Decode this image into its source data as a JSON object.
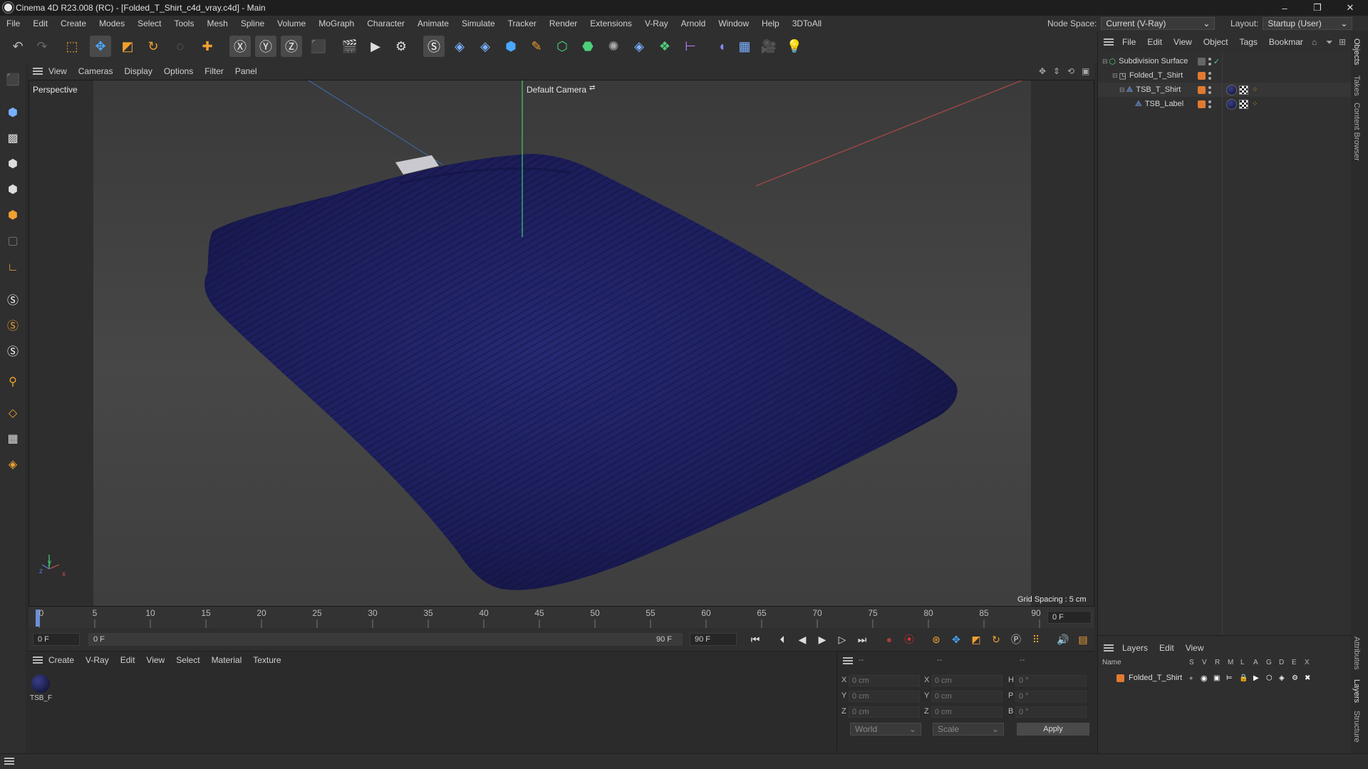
{
  "window": {
    "title": "Cinema 4D R23.008 (RC) - [Folded_T_Shirt_c4d_vray.c4d] - Main",
    "minimize": "–",
    "restore": "❐",
    "close": "✕"
  },
  "menubar": {
    "items": [
      "File",
      "Edit",
      "Create",
      "Modes",
      "Select",
      "Tools",
      "Mesh",
      "Spline",
      "Volume",
      "MoGraph",
      "Character",
      "Animate",
      "Simulate",
      "Tracker",
      "Render",
      "Extensions",
      "V-Ray",
      "Arnold",
      "Window",
      "Help",
      "3DToAll"
    ],
    "node_space_label": "Node Space:",
    "node_space_value": "Current (V-Ray)",
    "layout_label": "Layout:",
    "layout_value": "Startup (User)"
  },
  "toolbar": {
    "icons": [
      "undo-icon",
      "redo-icon",
      "live-select-icon",
      "move-icon",
      "scale-icon",
      "rotate-icon",
      "recent-tool-icon",
      "transform-icon",
      "x-axis-lock-icon",
      "y-axis-lock-icon",
      "z-axis-lock-icon",
      "coordinate-system-icon",
      "render-region-icon",
      "render-view-icon",
      "render-settings-icon",
      "vray-icon",
      "python-icon",
      "python-icon-2",
      "cube-icon",
      "pen-icon",
      "subdivision-icon",
      "extrude-icon",
      "cloner-icon",
      "python-icon-3",
      "mograph-icon",
      "symmetry-icon",
      "deformer-icon",
      "floor-icon",
      "camera-icon",
      "light-icon"
    ]
  },
  "viewport_menu": {
    "items": [
      "View",
      "Cameras",
      "Display",
      "Options",
      "Filter",
      "Panel"
    ]
  },
  "viewport": {
    "label": "Perspective",
    "camera": "Default Camera",
    "grid_spacing": "Grid Spacing : 5 cm",
    "axis_x": "x",
    "axis_y": "y",
    "axis_z": "z",
    "shirt_color": "#1c1d52"
  },
  "timeline": {
    "ticks": [
      "0",
      "5",
      "10",
      "15",
      "20",
      "25",
      "30",
      "35",
      "40",
      "45",
      "50",
      "55",
      "60",
      "65",
      "70",
      "75",
      "80",
      "85",
      "90"
    ],
    "current_frame_field": "0 F"
  },
  "transport": {
    "start_frame": "0 F",
    "range_start": "0 F",
    "range_end": "90 F",
    "end_frame": "90 F"
  },
  "material_manager": {
    "menu": [
      "Create",
      "V-Ray",
      "Edit",
      "View",
      "Select",
      "Material",
      "Texture"
    ],
    "materials": [
      {
        "label": "TSB_F"
      }
    ]
  },
  "coordinates": {
    "header": [
      "--",
      "--",
      "--"
    ],
    "rows": [
      {
        "p": "X",
        "pv": "0 cm",
        "s": "X",
        "sv": "0 cm",
        "r": "H",
        "rv": "0 °"
      },
      {
        "p": "Y",
        "pv": "0 cm",
        "s": "Y",
        "sv": "0 cm",
        "r": "P",
        "rv": "0 °"
      },
      {
        "p": "Z",
        "pv": "0 cm",
        "s": "Z",
        "sv": "0 cm",
        "r": "B",
        "rv": "0 °"
      }
    ],
    "mode": "World",
    "type": "Scale",
    "apply": "Apply"
  },
  "object_manager": {
    "menu": [
      "File",
      "Edit",
      "View",
      "Object",
      "Tags",
      "Bookmar"
    ],
    "objects": [
      {
        "name": "Subdivision Surface"
      },
      {
        "name": "Folded_T_Shirt"
      },
      {
        "name": "TSB_T_Shirt"
      },
      {
        "name": "TSB_Label"
      }
    ]
  },
  "layer_manager": {
    "menu": [
      "Layers",
      "Edit",
      "View"
    ],
    "columns": [
      "Name",
      "S",
      "V",
      "R",
      "M",
      "L",
      "A",
      "G",
      "D",
      "E",
      "X"
    ],
    "layers": [
      {
        "name": "Folded_T_Shirt"
      }
    ]
  },
  "side_tabs": [
    "Objects",
    "Takes",
    "Content Browser",
    "Attributes",
    "Layers",
    "Structure"
  ]
}
